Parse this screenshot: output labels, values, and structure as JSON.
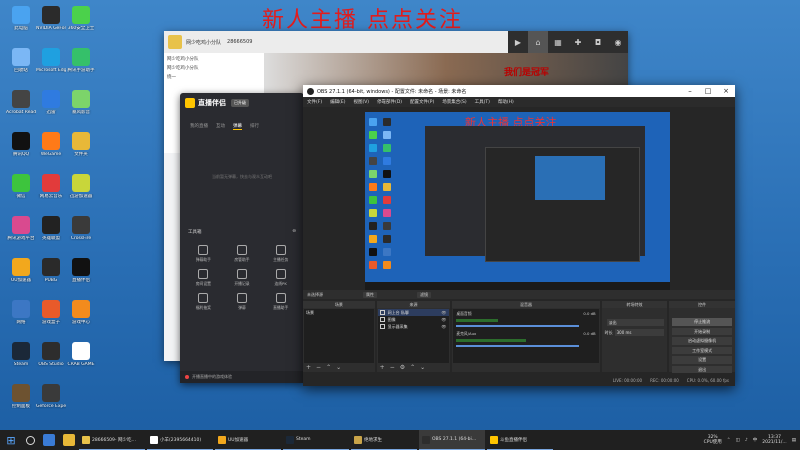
{
  "banner": "新人主播  点点关注",
  "desktop_icons": [
    {
      "label": "此电脑",
      "color": "#4aa3f0"
    },
    {
      "label": "NVIDIA GeForce Experience",
      "color": "#2b2b2b"
    },
    {
      "label": "360安全卫士",
      "color": "#4bd14b"
    },
    {
      "label": "回收站",
      "color": "#7bb7f5"
    },
    {
      "label": "Microsoft Edge",
      "color": "#1fa0e0"
    },
    {
      "label": "腾讯手游助手",
      "color": "#35c06a"
    },
    {
      "label": "Acrobat Reader",
      "color": "#444"
    },
    {
      "label": "迅雷",
      "color": "#2f7be0"
    },
    {
      "label": "暴风影音",
      "color": "#7cd46a"
    },
    {
      "label": "腾讯QQ",
      "color": "#111"
    },
    {
      "label": "WeGame",
      "color": "#ff7a18"
    },
    {
      "label": "文件夹",
      "color": "#e8b838"
    },
    {
      "label": "微信",
      "color": "#3dc43d"
    },
    {
      "label": "网易云音乐",
      "color": "#e23b3b"
    },
    {
      "label": "迅游加速器",
      "color": "#c8d63a"
    },
    {
      "label": "腾讯游戏平台",
      "color": "#d94a8f"
    },
    {
      "label": "英雄联盟",
      "color": "#222"
    },
    {
      "label": "CrossFire",
      "color": "#3a3a3a"
    },
    {
      "label": "UU加速器",
      "color": "#f2a81d"
    },
    {
      "label": "PUBG",
      "color": "#2a2a2a"
    },
    {
      "label": "直播伴侣",
      "color": "#111"
    },
    {
      "label": "网络",
      "color": "#3c77c4"
    },
    {
      "label": "游戏盒子",
      "color": "#e85a2a"
    },
    {
      "label": "游戏中心",
      "color": "#f28b1d"
    },
    {
      "label": "Steam",
      "color": "#1b2838"
    },
    {
      "label": "OBS Studio",
      "color": "#2d2d2d"
    },
    {
      "label": "CRAB GAME",
      "color": "#ffffff"
    },
    {
      "label": "控制面板",
      "color": "#6d5230"
    },
    {
      "label": "Geforce Experience",
      "color": "#3a3a3a"
    }
  ],
  "back_window": {
    "room": "网少吃鸡小分队",
    "room_id": "28666509",
    "promo_text": "我们是冠军",
    "side_items": [
      "网少吃鸡小分队",
      "网少吃鸡小分队",
      "绕一"
    ]
  },
  "companion": {
    "title": "直播伴侣",
    "badge": "已升级",
    "tabs": [
      "我的直播",
      "互动",
      "弹幕",
      "排行"
    ],
    "empty_text": "当前暂无弹幕，快去与观众互动吧",
    "tools_title": "工具箱",
    "tools": [
      "弹幕助手",
      "房管助手",
      "主播任务",
      "房间设置",
      "开播记录",
      "连线PK",
      "福利抽奖",
      "弹幕",
      "直播助手"
    ],
    "footer": "开播直播中的游戏体验"
  },
  "obs": {
    "title": "OBS 27.1.1 (64-bit, windows) - 配置文件: 未命名 - 场景: 未命名",
    "menu": [
      "文件(F)",
      "编辑(E)",
      "视图(V)",
      "停靠部件(D)",
      "配置文件(P)",
      "场景集合(S)",
      "工具(T)",
      "帮助(H)"
    ],
    "preview_banner": "新人主播  点点关注",
    "dock_bar": {
      "label": "未选择源",
      "properties": "属性",
      "filters": "滤镜"
    },
    "scenes": {
      "header": "场景",
      "items": [
        "场景"
      ]
    },
    "sources": {
      "header": "来源",
      "items": [
        {
          "name": "网上台 私聊",
          "visible": "👁"
        },
        {
          "name": "图像",
          "visible": "👁"
        },
        {
          "name": "显示器采集",
          "visible": "👁"
        }
      ]
    },
    "mixer": {
      "header": "混音器",
      "items": [
        {
          "name": "桌面音频",
          "db": "0.0 dB",
          "level": 0.3
        },
        {
          "name": "麦克风/Aux",
          "db": "0.0 dB",
          "level": 0.5
        }
      ]
    },
    "transitions": {
      "header": "转场特效",
      "type": "淡出",
      "duration_label": "时长",
      "duration": "300 ms"
    },
    "controls": {
      "header": "控件",
      "buttons": [
        "停止推流",
        "开始录制",
        "启动虚拟摄像机",
        "工作室模式",
        "设置",
        "退出"
      ]
    },
    "status": {
      "live": "LIVE: 00:00:00",
      "rec": "REC: 00:00:00",
      "cpu": "CPU: 0.0%, 60.00 fps"
    }
  },
  "taskbar": {
    "items": [
      {
        "label": "28666509- 网少吃…",
        "color": "#e8c24a"
      },
      {
        "label": "小羊(2395664410)",
        "color": "#ffffff"
      },
      {
        "label": "UU加速器",
        "color": "#f2a81d"
      },
      {
        "label": "Steam",
        "color": "#1b2838"
      },
      {
        "label": "绝地求生",
        "color": "#c9a449"
      },
      {
        "label": "OBS 27.1.1 (64-bi…",
        "color": "#2d2d2d"
      },
      {
        "label": "斗鱼直播伴侣",
        "color": "#ffc500"
      }
    ],
    "cpu": "32%",
    "cpu_label": "CPU使用",
    "time": "13:37",
    "date": "2021/11/..."
  }
}
